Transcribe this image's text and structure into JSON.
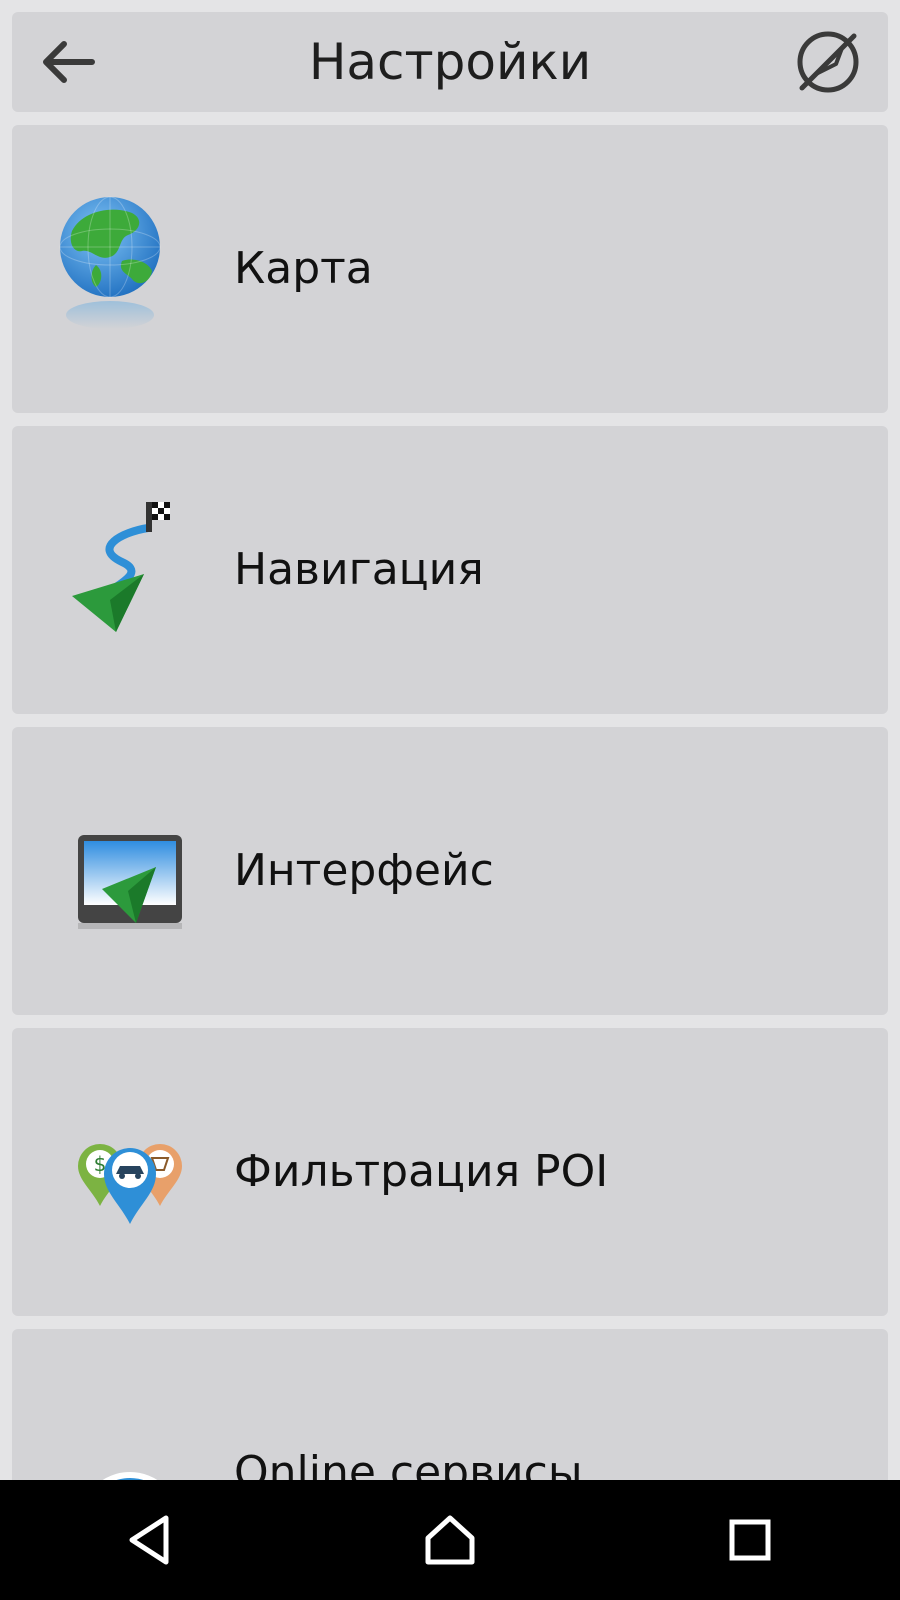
{
  "header": {
    "title": "Настройки",
    "back_icon": "arrow-left-icon",
    "right_icon": "compass-off-icon"
  },
  "items": [
    {
      "label": "Карта",
      "icon": "globe-icon"
    },
    {
      "label": "Навигация",
      "icon": "route-flag-icon"
    },
    {
      "label": "Интерфейс",
      "icon": "monitor-arrow-icon"
    },
    {
      "label": "Фильтрация POI",
      "icon": "poi-pins-icon"
    },
    {
      "label": "Online сервисы",
      "icon": "at-sign-icon"
    }
  ],
  "navbar": {
    "back_icon": "triangle-back-icon",
    "home_icon": "home-icon",
    "recents_icon": "square-recents-icon"
  },
  "colors": {
    "background": "#e4e4e6",
    "panel": "#d3d3d6",
    "text": "#1e1e1e",
    "navbar": "#000000",
    "accent_green": "#2c9a3c",
    "accent_blue": "#2e8fd7"
  }
}
